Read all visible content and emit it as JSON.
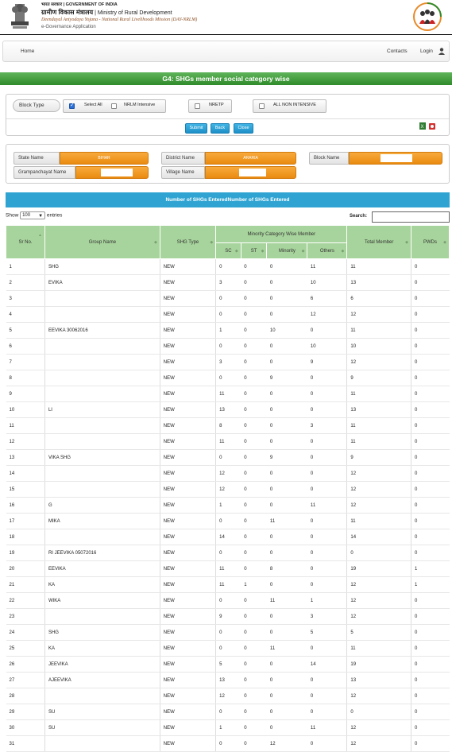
{
  "header": {
    "line1": "भारत सरकार  |  GOVERNMENT OF INDIA",
    "line2_hindi": "ग्रामीण विकास मंत्रालय",
    "line2_english": "Ministry of Rural Development",
    "line3": "Deendayal Antyodaya Yojana - National Rural Livelihoods Mission (DAY-NRLM)",
    "line4": "e-Governance Application"
  },
  "nav": {
    "home": "Home",
    "contacts": "Contacts",
    "login": "Login"
  },
  "page_title": "G4: SHGs member social category wise",
  "filters": {
    "block_type_label": "Block Type",
    "options": [
      {
        "label": "Select All",
        "checked": true
      },
      {
        "label": "NRLM Intensive",
        "checked": false
      },
      {
        "label": "NRETP",
        "checked": false
      },
      {
        "label": "ALL NON INTENSIVE",
        "checked": false
      }
    ],
    "buttons": {
      "submit": "Submit",
      "back": "Back",
      "close": "Close"
    }
  },
  "location": {
    "state_label": "State Name",
    "state_value": "BIHAR",
    "district_label": "District Name",
    "district_value": "ARARIA",
    "block_label": "Block Name",
    "block_value": "",
    "gp_label": "Grampanchayat Name",
    "gp_value": "",
    "village_label": "Village Name",
    "village_value": ""
  },
  "table_title": "Number of SHGs EnteredNumber of SHGs Entered",
  "controls": {
    "show_prefix": "Show",
    "show_value": "100",
    "show_suffix": "entries",
    "search_label": "Search:"
  },
  "columns": {
    "srno": "Sr No.",
    "group": "Group Name",
    "type": "SHG Type",
    "minority_group": "Minority Category Wise Member",
    "sc": "SC",
    "st": "ST",
    "minority": "Minority",
    "others": "Others",
    "total": "Total Member",
    "pwds": "PWDs"
  },
  "rows": [
    {
      "sr": "1",
      "name": "SHG",
      "type": "NEW",
      "sc": "0",
      "st": "0",
      "minority": "0",
      "others": "11",
      "total": "11",
      "pwds": "0"
    },
    {
      "sr": "2",
      "name": "EVIKA",
      "type": "NEW",
      "sc": "3",
      "st": "0",
      "minority": "0",
      "others": "10",
      "total": "13",
      "pwds": "0"
    },
    {
      "sr": "3",
      "name": "",
      "type": "NEW",
      "sc": "0",
      "st": "0",
      "minority": "0",
      "others": "6",
      "total": "6",
      "pwds": "0"
    },
    {
      "sr": "4",
      "name": "",
      "type": "NEW",
      "sc": "0",
      "st": "0",
      "minority": "0",
      "others": "12",
      "total": "12",
      "pwds": "0"
    },
    {
      "sr": "5",
      "name": "EEVIKA 30062016",
      "type": "NEW",
      "sc": "1",
      "st": "0",
      "minority": "10",
      "others": "0",
      "total": "11",
      "pwds": "0"
    },
    {
      "sr": "6",
      "name": "",
      "type": "NEW",
      "sc": "0",
      "st": "0",
      "minority": "0",
      "others": "10",
      "total": "10",
      "pwds": "0"
    },
    {
      "sr": "7",
      "name": "",
      "type": "NEW",
      "sc": "3",
      "st": "0",
      "minority": "0",
      "others": "9",
      "total": "12",
      "pwds": "0"
    },
    {
      "sr": "8",
      "name": "",
      "type": "NEW",
      "sc": "0",
      "st": "0",
      "minority": "9",
      "others": "0",
      "total": "9",
      "pwds": "0"
    },
    {
      "sr": "9",
      "name": "",
      "type": "NEW",
      "sc": "11",
      "st": "0",
      "minority": "0",
      "others": "0",
      "total": "11",
      "pwds": "0"
    },
    {
      "sr": "10",
      "name": "LI",
      "type": "NEW",
      "sc": "13",
      "st": "0",
      "minority": "0",
      "others": "0",
      "total": "13",
      "pwds": "0"
    },
    {
      "sr": "11",
      "name": "",
      "type": "NEW",
      "sc": "8",
      "st": "0",
      "minority": "0",
      "others": "3",
      "total": "11",
      "pwds": "0"
    },
    {
      "sr": "12",
      "name": "",
      "type": "NEW",
      "sc": "11",
      "st": "0",
      "minority": "0",
      "others": "0",
      "total": "11",
      "pwds": "0"
    },
    {
      "sr": "13",
      "name": "VIKA SHG",
      "type": "NEW",
      "sc": "0",
      "st": "0",
      "minority": "9",
      "others": "0",
      "total": "9",
      "pwds": "0"
    },
    {
      "sr": "14",
      "name": "",
      "type": "NEW",
      "sc": "12",
      "st": "0",
      "minority": "0",
      "others": "0",
      "total": "12",
      "pwds": "0"
    },
    {
      "sr": "15",
      "name": "",
      "type": "NEW",
      "sc": "12",
      "st": "0",
      "minority": "0",
      "others": "0",
      "total": "12",
      "pwds": "0"
    },
    {
      "sr": "16",
      "name": "G",
      "type": "NEW",
      "sc": "1",
      "st": "0",
      "minority": "0",
      "others": "11",
      "total": "12",
      "pwds": "0"
    },
    {
      "sr": "17",
      "name": "MIKA",
      "type": "NEW",
      "sc": "0",
      "st": "0",
      "minority": "11",
      "others": "0",
      "total": "11",
      "pwds": "0"
    },
    {
      "sr": "18",
      "name": "",
      "type": "NEW",
      "sc": "14",
      "st": "0",
      "minority": "0",
      "others": "0",
      "total": "14",
      "pwds": "0"
    },
    {
      "sr": "19",
      "name": "RI JEEVIKA 05072016",
      "type": "NEW",
      "sc": "0",
      "st": "0",
      "minority": "0",
      "others": "0",
      "total": "0",
      "pwds": "0"
    },
    {
      "sr": "20",
      "name": "EEVIKA",
      "type": "NEW",
      "sc": "11",
      "st": "0",
      "minority": "8",
      "others": "0",
      "total": "19",
      "pwds": "1"
    },
    {
      "sr": "21",
      "name": "KA",
      "type": "NEW",
      "sc": "11",
      "st": "1",
      "minority": "0",
      "others": "0",
      "total": "12",
      "pwds": "1"
    },
    {
      "sr": "22",
      "name": "WIKA",
      "type": "NEW",
      "sc": "0",
      "st": "0",
      "minority": "11",
      "others": "1",
      "total": "12",
      "pwds": "0"
    },
    {
      "sr": "23",
      "name": "",
      "type": "NEW",
      "sc": "9",
      "st": "0",
      "minority": "0",
      "others": "3",
      "total": "12",
      "pwds": "0"
    },
    {
      "sr": "24",
      "name": "SHG",
      "type": "NEW",
      "sc": "0",
      "st": "0",
      "minority": "0",
      "others": "5",
      "total": "5",
      "pwds": "0"
    },
    {
      "sr": "25",
      "name": "KA",
      "type": "NEW",
      "sc": "0",
      "st": "0",
      "minority": "11",
      "others": "0",
      "total": "11",
      "pwds": "0"
    },
    {
      "sr": "26",
      "name": "JEEVIKA",
      "type": "NEW",
      "sc": "5",
      "st": "0",
      "minority": "0",
      "others": "14",
      "total": "19",
      "pwds": "0"
    },
    {
      "sr": "27",
      "name": "AJEEVIKA",
      "type": "NEW",
      "sc": "13",
      "st": "0",
      "minority": "0",
      "others": "0",
      "total": "13",
      "pwds": "0"
    },
    {
      "sr": "28",
      "name": "",
      "type": "NEW",
      "sc": "12",
      "st": "0",
      "minority": "0",
      "others": "0",
      "total": "12",
      "pwds": "0"
    },
    {
      "sr": "29",
      "name": "SU",
      "type": "NEW",
      "sc": "0",
      "st": "0",
      "minority": "0",
      "others": "0",
      "total": "0",
      "pwds": "0"
    },
    {
      "sr": "30",
      "name": "SU",
      "type": "NEW",
      "sc": "1",
      "st": "0",
      "minority": "0",
      "others": "11",
      "total": "12",
      "pwds": "0"
    },
    {
      "sr": "31",
      "name": "",
      "type": "NEW",
      "sc": "0",
      "st": "0",
      "minority": "12",
      "others": "0",
      "total": "12",
      "pwds": "0"
    }
  ]
}
